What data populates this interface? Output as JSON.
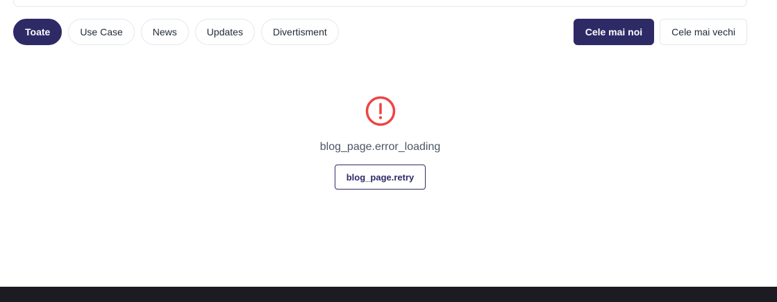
{
  "filters": {
    "items": [
      {
        "label": "Toate",
        "active": true
      },
      {
        "label": "Use Case",
        "active": false
      },
      {
        "label": "News",
        "active": false
      },
      {
        "label": "Updates",
        "active": false
      },
      {
        "label": "Divertisment",
        "active": false
      }
    ]
  },
  "sort": {
    "newest_label": "Cele mai noi",
    "oldest_label": "Cele mai vechi",
    "active": "newest"
  },
  "error": {
    "icon": "alert-circle-icon",
    "message": "blog_page.error_loading",
    "retry_label": "blog_page.retry"
  },
  "colors": {
    "accent": "#2d2a66",
    "error": "#ef4444",
    "footer": "#1c1b22",
    "border": "#e5e7eb"
  }
}
